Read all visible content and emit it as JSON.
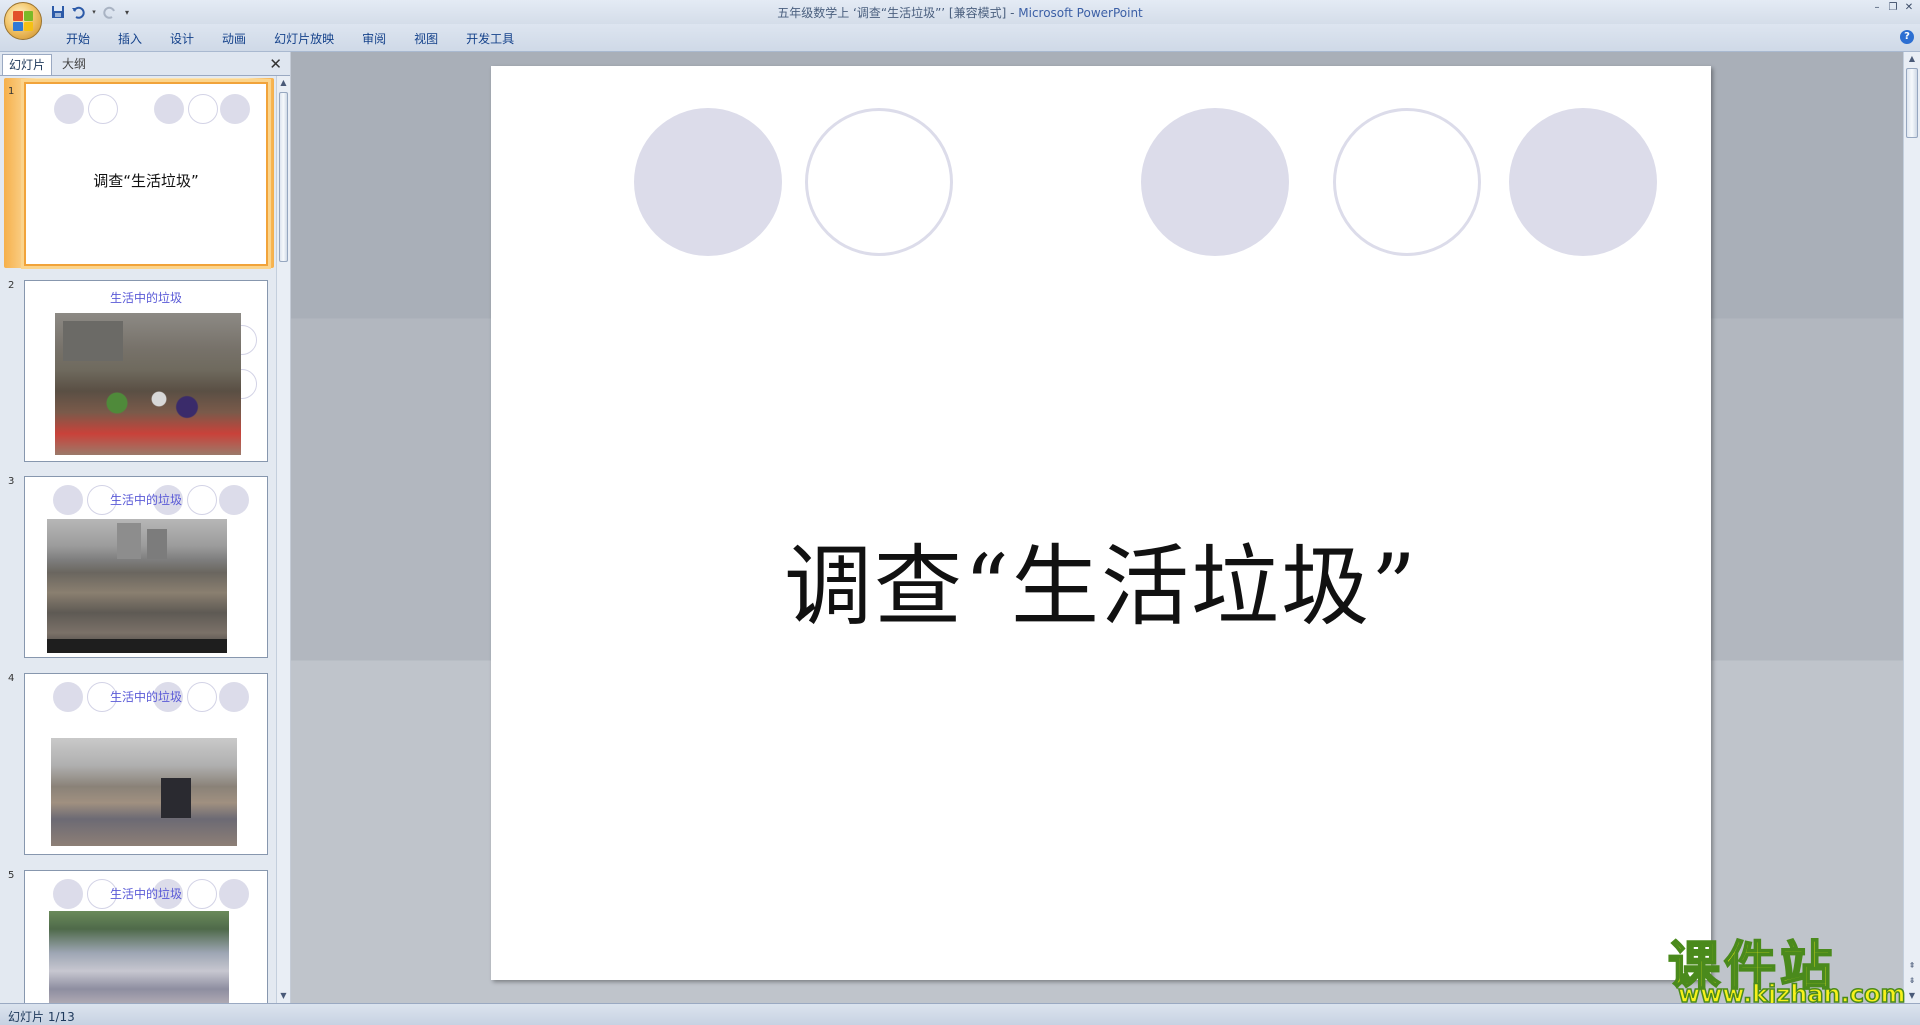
{
  "window": {
    "title_prefix": "五年级数学上 ‘调查“生活垃圾”’ [兼容模式] - ",
    "app_name": "Microsoft PowerPoint"
  },
  "ribbon": {
    "tabs": [
      "开始",
      "插入",
      "设计",
      "动画",
      "幻灯片放映",
      "审阅",
      "视图",
      "开发工具"
    ]
  },
  "panel": {
    "tab_slides": "幻灯片",
    "tab_outline": "大纲",
    "close": "✕"
  },
  "thumbnails": [
    {
      "num": "1",
      "title": "调查“生活垃圾”"
    },
    {
      "num": "2",
      "title": "生活中的垃圾"
    },
    {
      "num": "3",
      "title": "生活中的垃圾"
    },
    {
      "num": "4",
      "title": "生活中的垃圾"
    },
    {
      "num": "5",
      "title": "生活中的垃圾"
    }
  ],
  "slide": {
    "title": "调查“生活垃圾”"
  },
  "status": {
    "text": "幻灯片 1/13"
  },
  "watermark": {
    "big": "课件站",
    "small": "www.kjzhan.com"
  },
  "colors": {
    "circle_fill": "#dcdcea",
    "thumb_title": "#5a5ad7",
    "selection": "#f1a33a"
  }
}
